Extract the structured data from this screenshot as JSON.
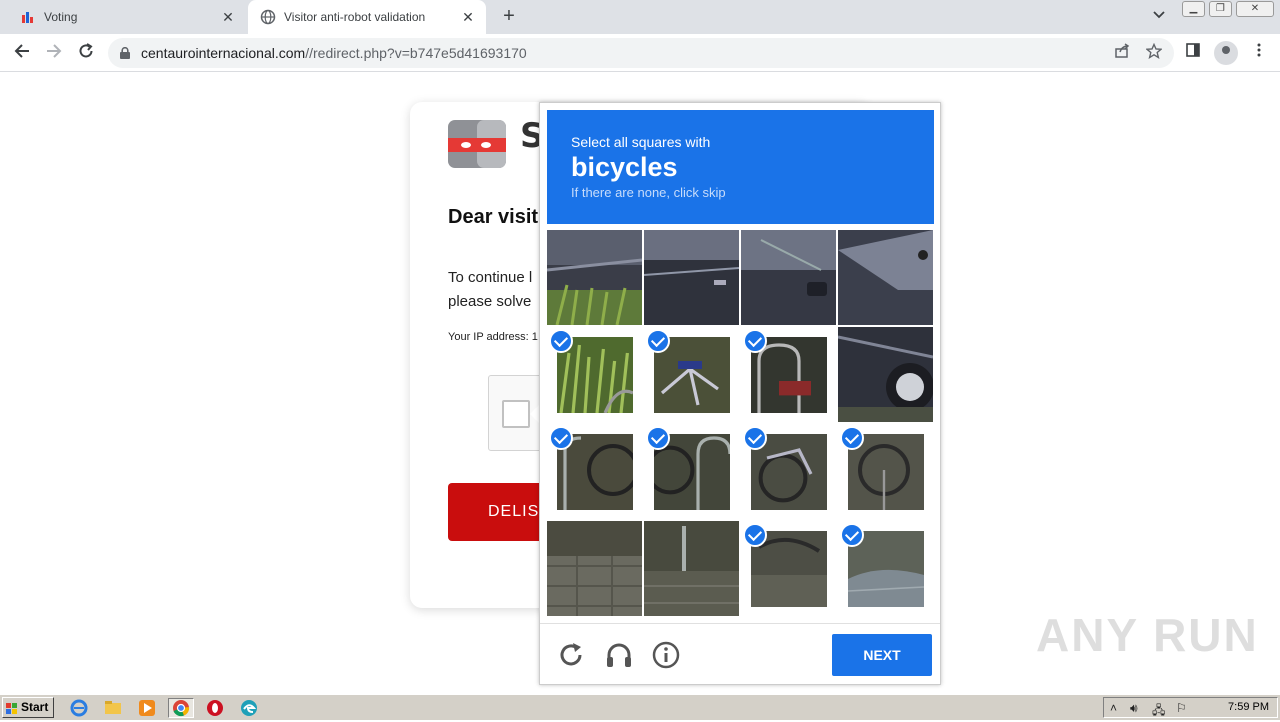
{
  "browser": {
    "tabs": [
      {
        "title": "Voting",
        "close": "✕"
      },
      {
        "title": "Visitor anti-robot validation",
        "close": "✕"
      }
    ],
    "new_tab": "+",
    "tab_menu": "⌄",
    "url_host": "centaurointernacional.com",
    "url_path": "//redirect.php?v=b747e5d41693170"
  },
  "page": {
    "logo_letter": "S",
    "greeting": "Dear visit",
    "para_line1": "To continue l",
    "para_line2": "please solve",
    "ip_label": "Your IP address: 1",
    "delist_label": "DELIS"
  },
  "challenge": {
    "instruction": "Select all squares with",
    "target": "bicycles",
    "hint": "If there are none, click skip",
    "next_label": "NEXT",
    "tiles": [
      {
        "content": "car door and grass",
        "selected": false
      },
      {
        "content": "car door",
        "selected": false
      },
      {
        "content": "car side mirror",
        "selected": false
      },
      {
        "content": "car windshield",
        "selected": false
      },
      {
        "content": "grass",
        "selected": true
      },
      {
        "content": "bicycle frame",
        "selected": true
      },
      {
        "content": "bicycle rack",
        "selected": true
      },
      {
        "content": "car wheel",
        "selected": false
      },
      {
        "content": "bicycle wheel",
        "selected": true
      },
      {
        "content": "bicycle wheel",
        "selected": true
      },
      {
        "content": "bicycle",
        "selected": true
      },
      {
        "content": "bicycle wheel",
        "selected": true
      },
      {
        "content": "pavement",
        "selected": false
      },
      {
        "content": "pavement and rack",
        "selected": false
      },
      {
        "content": "bicycle wheel",
        "selected": true
      },
      {
        "content": "wet pavement",
        "selected": true
      }
    ]
  },
  "watermark": "ANY RUN",
  "taskbar": {
    "start_label": "Start",
    "clock": "7:59 PM"
  },
  "colors": {
    "accent": "#1a73e8",
    "delist_red": "#c90d0d"
  }
}
